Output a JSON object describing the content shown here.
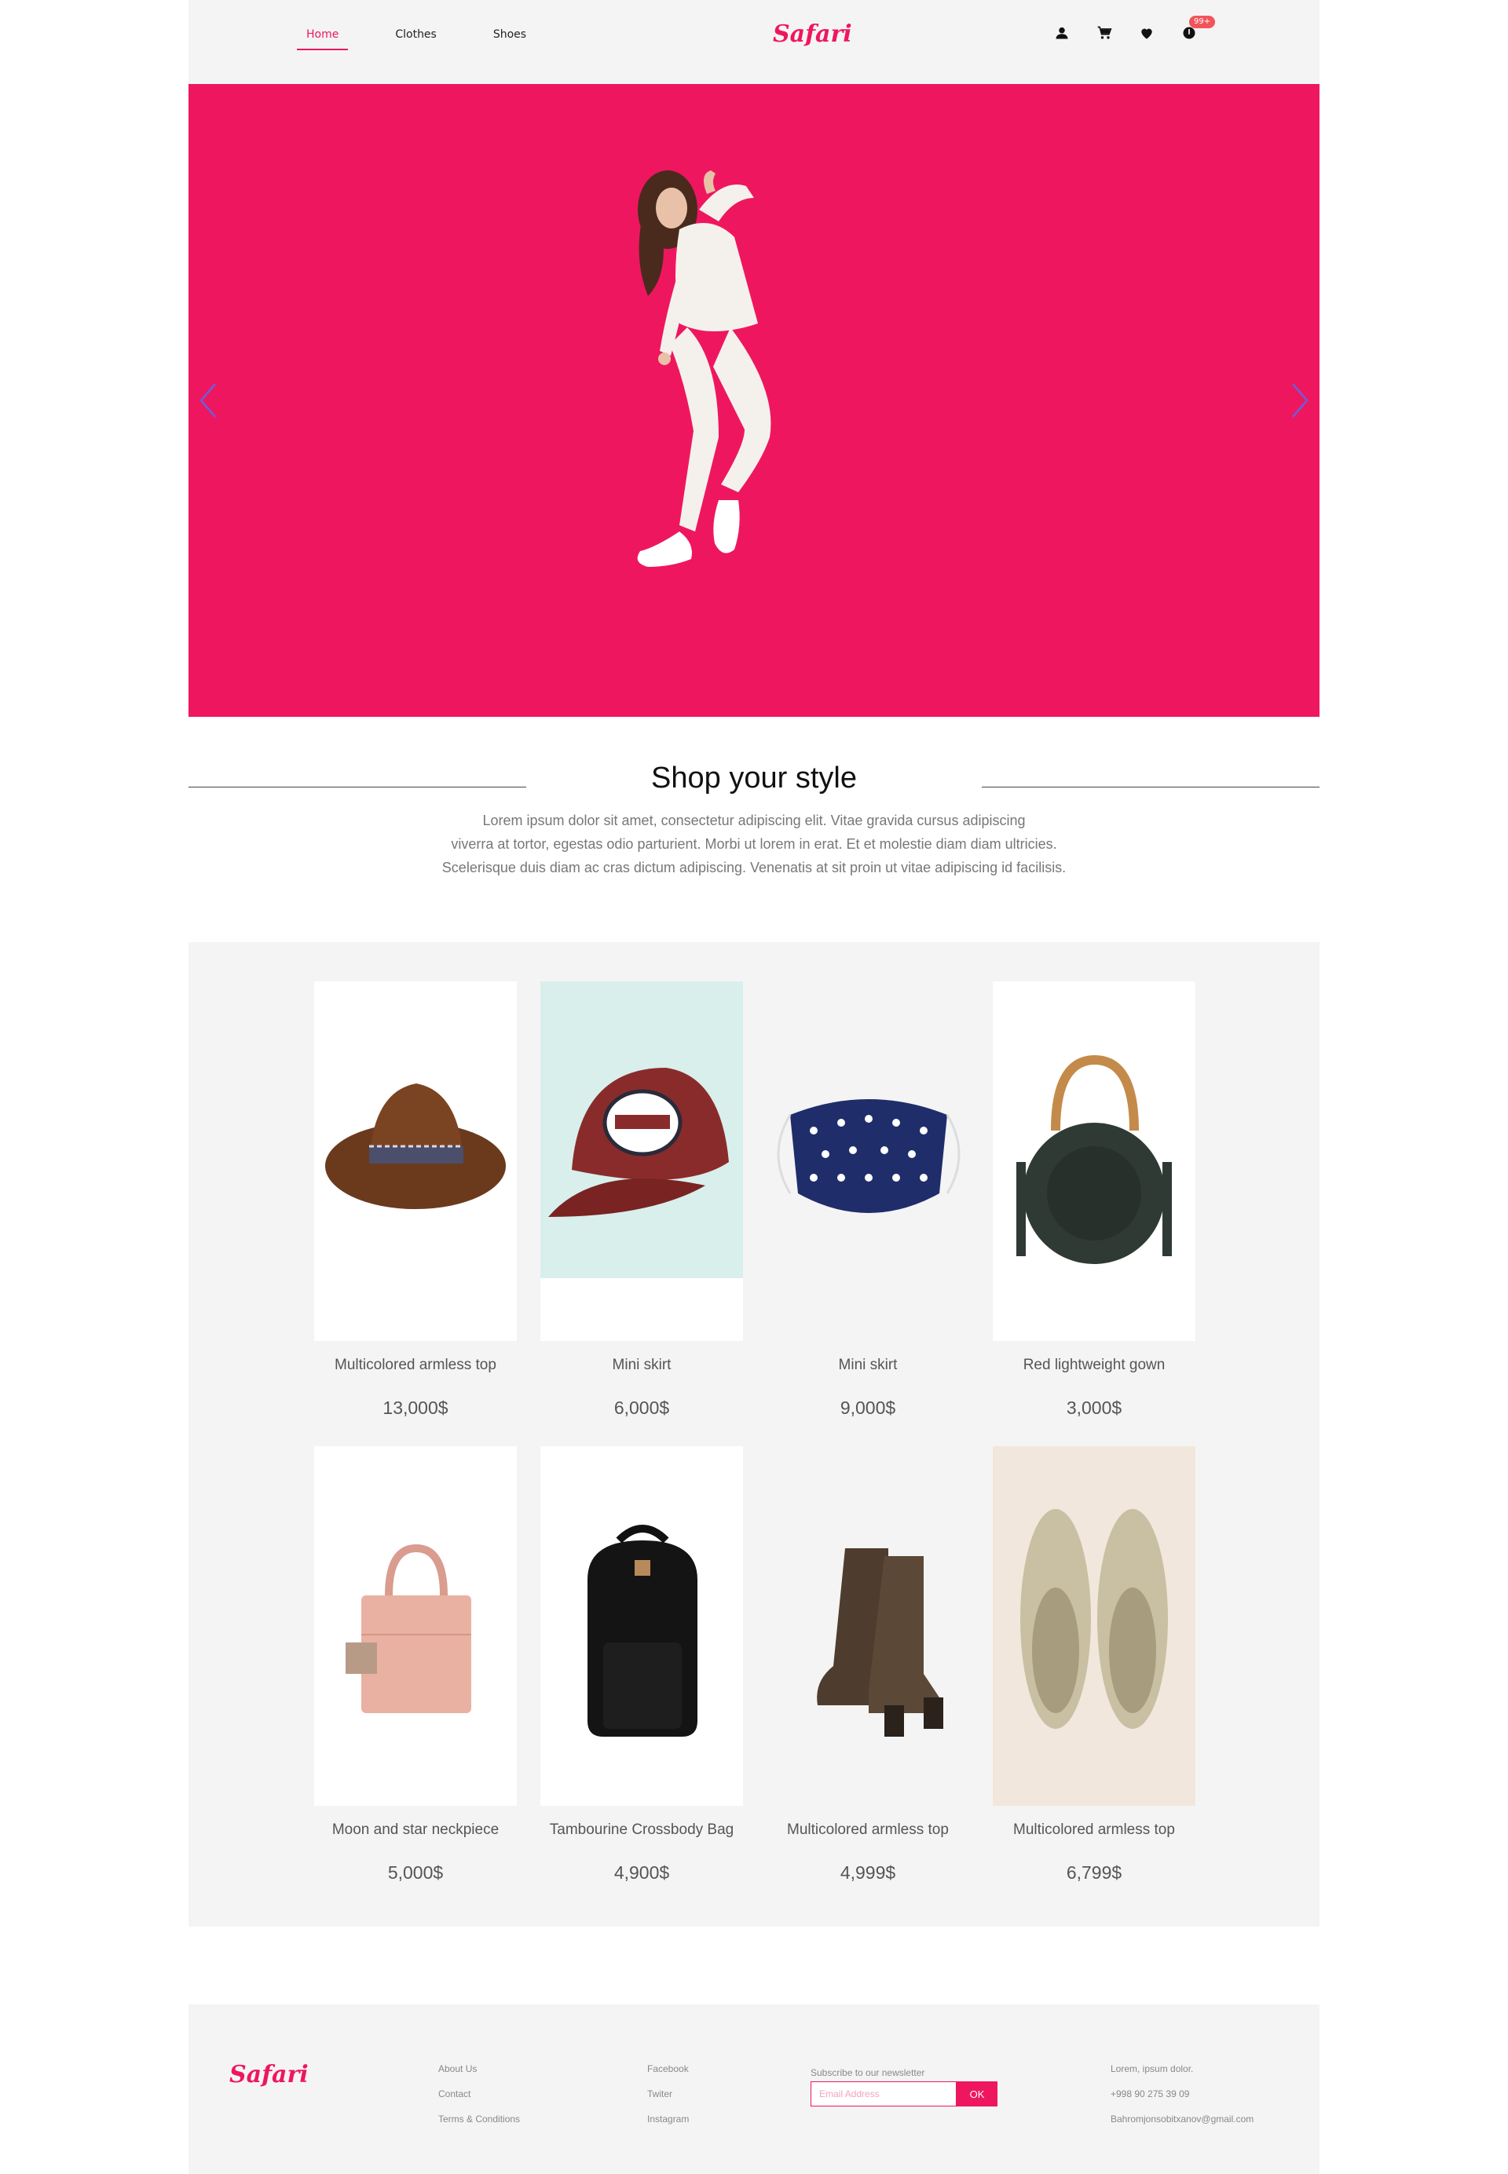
{
  "header": {
    "nav": [
      "Home",
      "Clothes",
      "Shoes"
    ],
    "logo": "Safari",
    "icons": [
      "user-icon",
      "cart-icon",
      "heart-icon",
      "notification-icon"
    ],
    "badge": "99+"
  },
  "hero": {
    "background": "#ef1660",
    "arrows": [
      "chevron-left-icon",
      "chevron-right-icon"
    ]
  },
  "section": {
    "title": "Shop your style",
    "desc_lines": [
      "Lorem ipsum dolor sit amet, consectetur adipiscing elit. Vitae gravida cursus adipiscing",
      "viverra at tortor, egestas odio parturient. Morbi ut lorem in erat. Et et molestie diam diam ultricies.",
      "Scelerisque duis diam ac cras dictum adipiscing. Venenatis at sit proin ut vitae adipiscing id facilisis."
    ]
  },
  "products": [
    {
      "name": "Multicolored armless top",
      "price": "13,000$",
      "image": "cowboy-hat"
    },
    {
      "name": "Mini skirt",
      "price": "6,000$",
      "image": "baseball-cap"
    },
    {
      "name": "Mini skirt",
      "price": "9,000$",
      "image": "face-mask"
    },
    {
      "name": "Red lightweight gown",
      "price": "3,000$",
      "image": "round-bag"
    },
    {
      "name": "Moon and star neckpiece",
      "price": "5,000$",
      "image": "pink-handbag"
    },
    {
      "name": "Tambourine Crossbody Bag",
      "price": "4,900$",
      "image": "black-backpack"
    },
    {
      "name": "Multicolored armless top",
      "price": "4,999$",
      "image": "brown-boots"
    },
    {
      "name": "Multicolored armless top",
      "price": "6,799$",
      "image": "canvas-sneakers"
    }
  ],
  "footer": {
    "logo": "Safari",
    "col1": [
      "About Us",
      "Contact",
      "Terms & Conditions"
    ],
    "col2": [
      "Facebook",
      "Twiter",
      "Instagram"
    ],
    "newsletter_label": "Subscribe to our newsletter",
    "newsletter_placeholder": "Email Address",
    "newsletter_button": "OK",
    "contact": [
      "Lorem, ipsum dolor.",
      "+998 90 275 39 09",
      "Bahromjonsobitxanov@gmail.com"
    ]
  },
  "colors": {
    "accent": "#ef1660",
    "panel": "#f4f4f4"
  }
}
